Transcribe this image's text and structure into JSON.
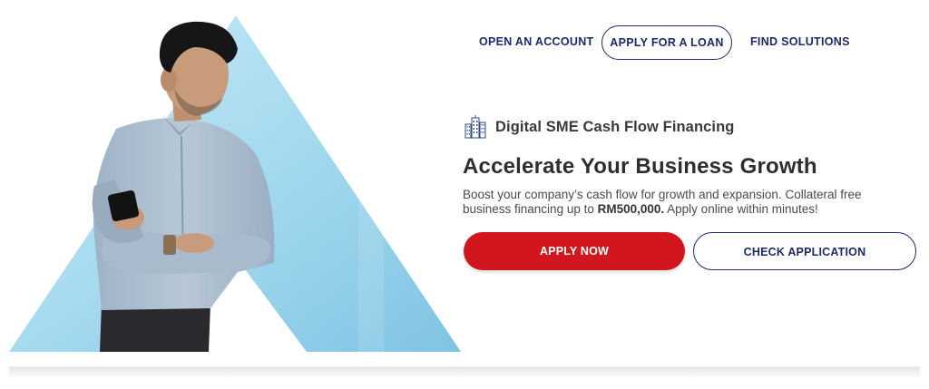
{
  "nav": {
    "open_account": "OPEN AN ACCOUNT",
    "apply_loan": "APPLY FOR A LOAN",
    "find_solutions": "FIND SOLUTIONS"
  },
  "hero": {
    "product_icon": "buildings-icon",
    "product_name": "Digital SME Cash Flow Financing",
    "headline": "Accelerate Your Business Growth",
    "desc_part1": "Boost your company’s cash flow for growth and expansion. Collateral free business financing up to ",
    "desc_amount": "RM500,000.",
    "desc_part2": " Apply online within minutes!",
    "apply_now": "APPLY NOW",
    "check_application": "CHECK APPLICATION"
  },
  "colors": {
    "brand_navy": "#1b2a6b",
    "brand_red": "#d1161e",
    "triangle_blue": "#a9dcef"
  }
}
